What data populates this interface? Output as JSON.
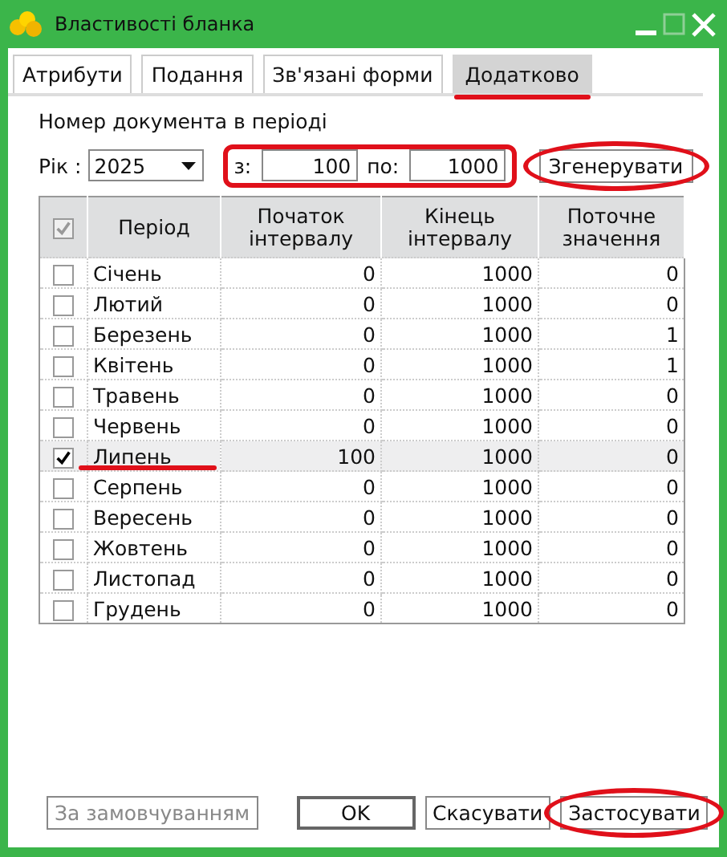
{
  "window": {
    "title": "Властивості бланка",
    "maximize_disabled": true
  },
  "tabs": [
    {
      "label": "Атрибути",
      "selected": false,
      "highlighted": false
    },
    {
      "label": "Подання",
      "selected": false,
      "highlighted": false
    },
    {
      "label": "Зв'язані форми",
      "selected": false,
      "highlighted": false
    },
    {
      "label": "Додатково",
      "selected": true,
      "highlighted": true
    }
  ],
  "section_label": "Номер документа в періоді",
  "year": {
    "label": "Рік :",
    "value": "2025"
  },
  "range": {
    "highlighted": true,
    "from_label": "з:",
    "from_value": "100",
    "to_label": "по:",
    "to_value": "1000"
  },
  "generate_button": {
    "label": "Згенерувати",
    "highlighted": true
  },
  "table": {
    "header_checkbox": {
      "checked": true,
      "disabled": true
    },
    "columns": [
      "Період",
      "Початок інтервалу",
      "Кінець інтервалу",
      "Поточне значення"
    ],
    "rows": [
      {
        "checked": false,
        "selected": false,
        "highlighted": false,
        "cells": [
          "Січень",
          "0",
          "1000",
          "0"
        ]
      },
      {
        "checked": false,
        "selected": false,
        "highlighted": false,
        "cells": [
          "Лютий",
          "0",
          "1000",
          "0"
        ]
      },
      {
        "checked": false,
        "selected": false,
        "highlighted": false,
        "cells": [
          "Березень",
          "0",
          "1000",
          "1"
        ]
      },
      {
        "checked": false,
        "selected": false,
        "highlighted": false,
        "cells": [
          "Квітень",
          "0",
          "1000",
          "1"
        ]
      },
      {
        "checked": false,
        "selected": false,
        "highlighted": false,
        "cells": [
          "Травень",
          "0",
          "1000",
          "0"
        ]
      },
      {
        "checked": false,
        "selected": false,
        "highlighted": false,
        "cells": [
          "Червень",
          "0",
          "1000",
          "0"
        ]
      },
      {
        "checked": true,
        "selected": true,
        "highlighted": true,
        "cells": [
          "Липень",
          "100",
          "1000",
          "0"
        ]
      },
      {
        "checked": false,
        "selected": false,
        "highlighted": false,
        "cells": [
          "Серпень",
          "0",
          "1000",
          "0"
        ]
      },
      {
        "checked": false,
        "selected": false,
        "highlighted": false,
        "cells": [
          "Вересень",
          "0",
          "1000",
          "0"
        ]
      },
      {
        "checked": false,
        "selected": false,
        "highlighted": false,
        "cells": [
          "Жовтень",
          "0",
          "1000",
          "0"
        ]
      },
      {
        "checked": false,
        "selected": false,
        "highlighted": false,
        "cells": [
          "Листопад",
          "0",
          "1000",
          "0"
        ]
      },
      {
        "checked": false,
        "selected": false,
        "highlighted": false,
        "cells": [
          "Грудень",
          "0",
          "1000",
          "0"
        ]
      }
    ]
  },
  "buttons": [
    {
      "label": "За замовчуванням",
      "disabled": true,
      "default": false,
      "highlighted": false
    },
    {
      "label": "OK",
      "disabled": false,
      "default": true,
      "highlighted": false
    },
    {
      "label": "Скасувати",
      "disabled": false,
      "default": false,
      "highlighted": false
    },
    {
      "label": "Застосувати",
      "disabled": false,
      "default": false,
      "highlighted": true
    }
  ]
}
